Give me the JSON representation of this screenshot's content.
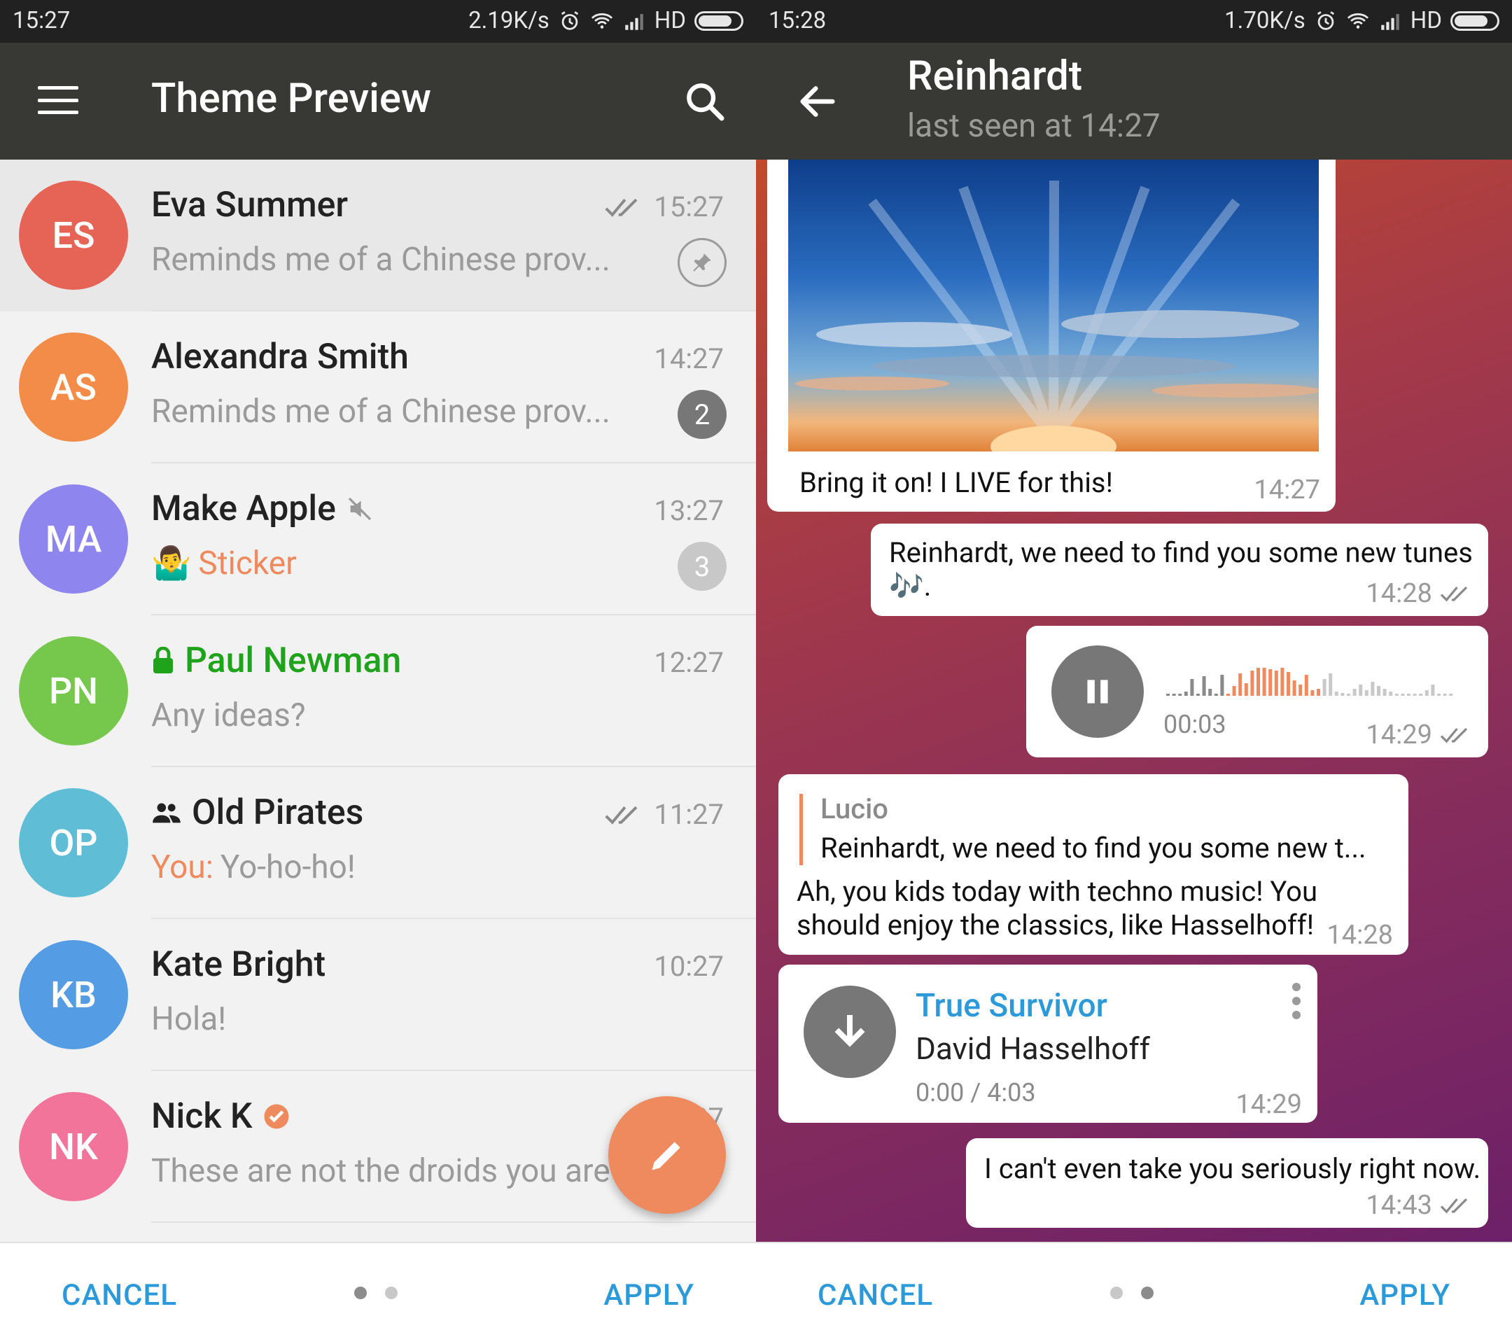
{
  "left": {
    "status": {
      "time": "15:27",
      "speed": "2.19K/s",
      "network": "HD"
    },
    "title": "Theme Preview",
    "chats": [
      {
        "initials": "ES",
        "name": "Eva Summer",
        "time": "15:27",
        "message": "Reminds me of a Chinese prov...",
        "color": "#e56456",
        "read": true,
        "pinned": true
      },
      {
        "initials": "AS",
        "name": "Alexandra Smith",
        "time": "14:27",
        "message": "Reminds me of a Chinese prov...",
        "color": "#f28c48",
        "unread": "2",
        "badge_color": "#777777"
      },
      {
        "initials": "MA",
        "name": "Make Apple",
        "time": "13:27",
        "message": "Sticker",
        "message_emoji": "🤷‍♂️",
        "color": "#8e85ee",
        "muted": true,
        "unread": "3",
        "badge_color": "#c8c8c8"
      },
      {
        "initials": "PN",
        "name": "Paul Newman",
        "time": "12:27",
        "message": "Any ideas?",
        "color": "#76c84d",
        "secret": true
      },
      {
        "initials": "OP",
        "name": "Old Pirates",
        "time": "11:27",
        "message_prefix": "You:",
        "message": "Yo-ho-ho!",
        "color": "#5fbed5",
        "group": true,
        "read": true
      },
      {
        "initials": "KB",
        "name": "Kate Bright",
        "time": "10:27",
        "message": "Hola!",
        "color": "#549ce3"
      },
      {
        "initials": "NK",
        "name": "Nick K",
        "time": "9:27",
        "message": "These are not the droids you are looking for",
        "color": "#f2749a",
        "verified": true
      }
    ],
    "bottom": {
      "cancel": "CANCEL",
      "apply": "APPLY"
    }
  },
  "right": {
    "status": {
      "time": "15:28",
      "speed": "1.70K/s",
      "network": "HD"
    },
    "peer_name": "Reinhardt",
    "peer_status": "last seen at 14:27",
    "messages": {
      "photo_caption": "Bring it on! I LIVE for this!",
      "photo_time": "14:27",
      "tunes_line1": "Reinhardt, we need to find you some new tunes",
      "tunes_line2": "🎶.",
      "tunes_time": "14:28",
      "voice_duration": "00:03",
      "voice_time": "14:29",
      "voice_progress": 0.55,
      "reply_author": "Lucio",
      "reply_quote": "Reinhardt, we need to find you some new t...",
      "reply_line1": "Ah, you kids today with techno music! You",
      "reply_line2": "should enjoy the classics, like Hasselhoff!",
      "reply_time": "14:28",
      "song_title": "True Survivor",
      "song_artist": "David Hasselhoff",
      "song_progress": "0:00 / 4:03",
      "song_time": "14:29",
      "last_text": "I can't even take you seriously right now.",
      "last_time": "14:43"
    },
    "bottom": {
      "cancel": "CANCEL",
      "apply": "APPLY"
    }
  },
  "colors": {
    "accent": "#ee8a5e",
    "link": "#2c9ad8",
    "app_bar": "#383834",
    "secret_green": "#1ea31b"
  }
}
